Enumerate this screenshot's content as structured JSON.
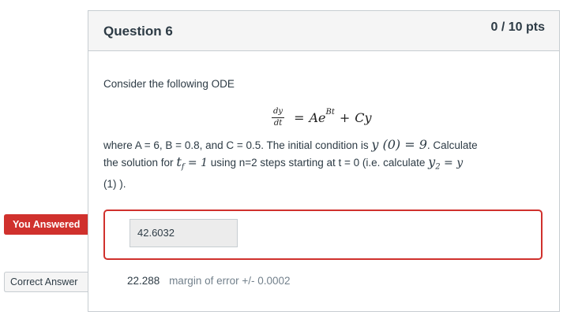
{
  "question": {
    "title": "Question 6",
    "points": "0 / 10 pts",
    "intro": "Consider the following ODE",
    "equation": {
      "lhs_num": "dy",
      "lhs_den": "dt",
      "equals": "=",
      "term1": "Ae",
      "term1_exp": "Bt",
      "plus": "+",
      "term2": "Cy"
    },
    "line1_a": "where A = 6, B = 0.8, and C = 0.5.  The initial condition is ",
    "line1_math": "y (0) = 9",
    "line1_b": ".  Calculate",
    "line2_a": "the solution for ",
    "line2_math": "t",
    "line2_sub": "f",
    "line2_math_b": " = 1",
    "line2_b": " using n=2 steps starting at t = 0 (i.e. calculate ",
    "line2_math2": "y",
    "line2_sub2": "2",
    "line2_math2_b": " = y",
    "line3": "(1) )."
  },
  "answer": {
    "tag": "You Answered",
    "value": "42.6032",
    "tag_color": "#d0312d"
  },
  "correct": {
    "tag": "Correct Answer",
    "value": "22.288",
    "margin": "margin of error +/- 0.0002"
  }
}
